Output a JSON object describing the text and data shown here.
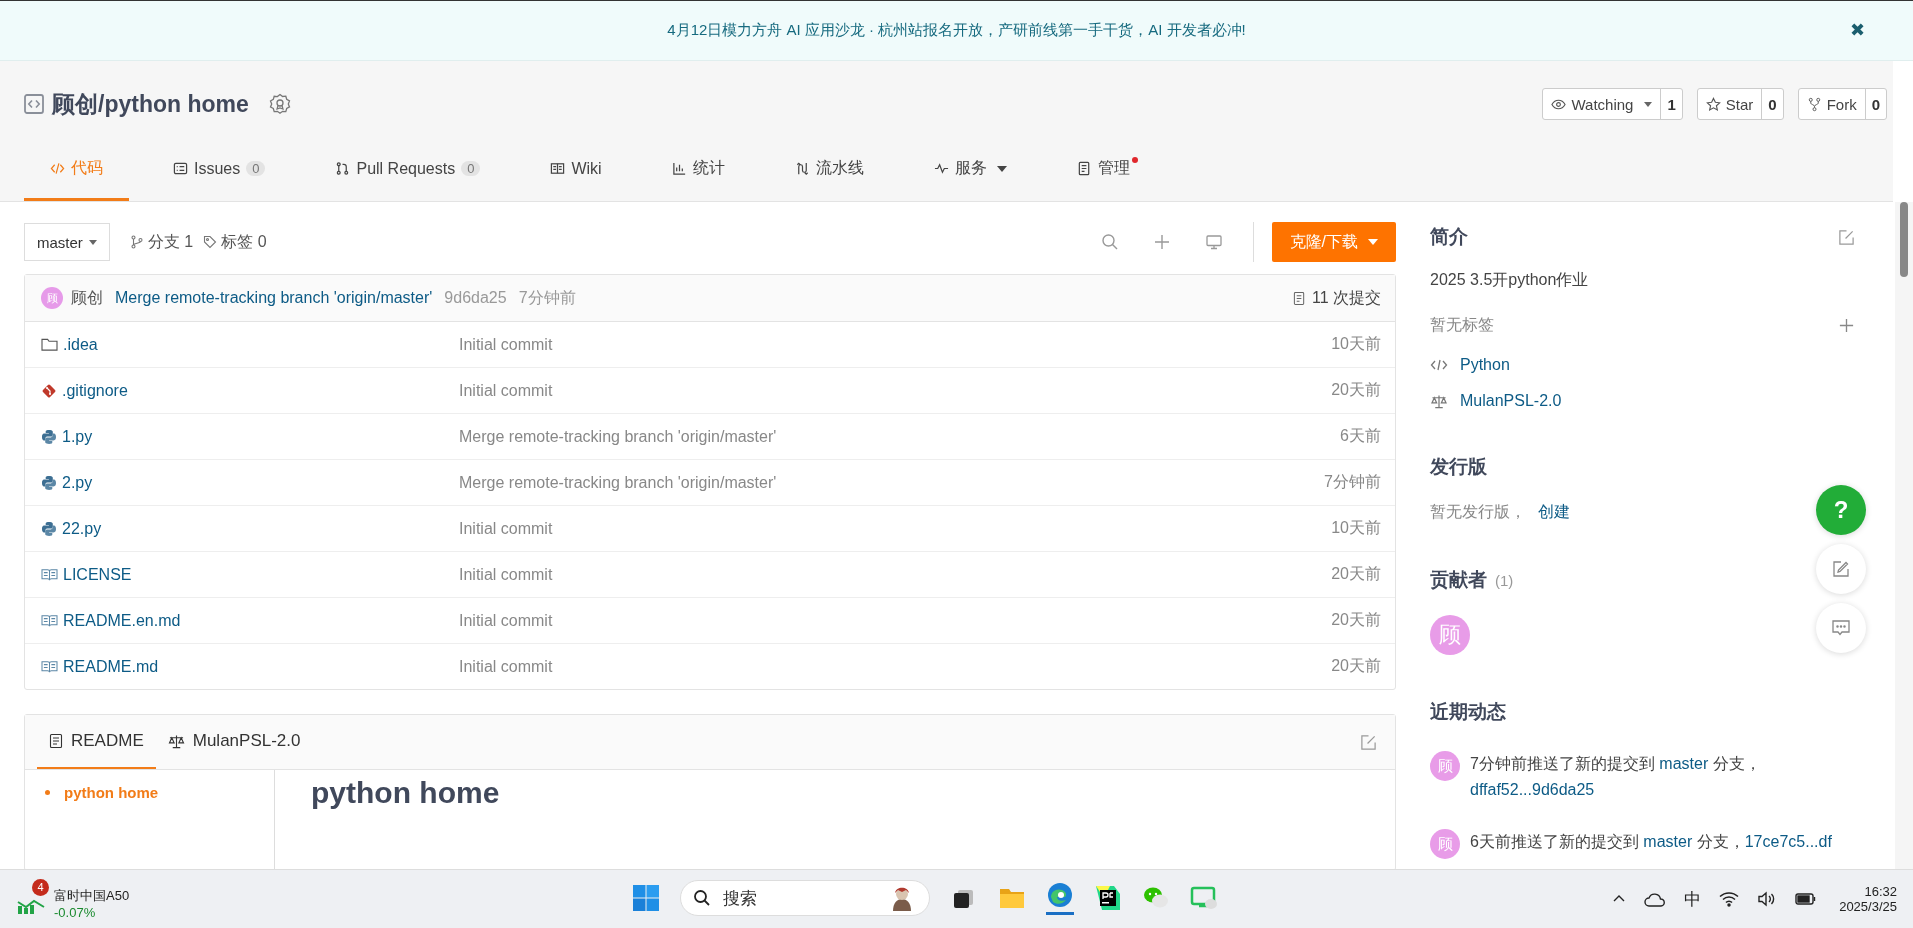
{
  "banner": {
    "text": "4月12日模力方舟 AI 应用沙龙 · 杭州站报名开放，产研前线第一手干货，AI 开发者必冲!",
    "close": "✖"
  },
  "repo": {
    "title": "顾创/python home",
    "actions": [
      {
        "label": "Watching",
        "count": "1",
        "caret": true
      },
      {
        "label": "Star",
        "count": "0",
        "caret": false
      },
      {
        "label": "Fork",
        "count": "0",
        "caret": false
      }
    ]
  },
  "tabs": [
    {
      "label": "代码",
      "selected": true
    },
    {
      "label": "Issues",
      "count": "0",
      "selected": false
    },
    {
      "label": "Pull Requests",
      "count": "0",
      "selected": false
    },
    {
      "label": "Wiki",
      "selected": false
    },
    {
      "label": "统计",
      "selected": false
    },
    {
      "label": "流水线",
      "selected": false
    },
    {
      "label": "服务",
      "caret": true,
      "selected": false
    },
    {
      "label": "管理",
      "dot": true,
      "selected": false
    }
  ],
  "toolbar": {
    "branch": "master",
    "branches": "分支 1",
    "tags": "标签 0",
    "clone": "克隆/下载"
  },
  "commit": {
    "avatar": "顾",
    "author": "顾创",
    "message": "Merge remote-tracking branch 'origin/master'",
    "hash": "9d6da25",
    "time": "7分钟前",
    "count": "11 次提交"
  },
  "files": [
    {
      "kind": "folder",
      "name": ".idea",
      "message": "Initial commit",
      "time": "10天前"
    },
    {
      "kind": "git",
      "name": ".gitignore",
      "message": "Initial commit",
      "time": "20天前"
    },
    {
      "kind": "python",
      "name": "1.py",
      "message": "Merge remote-tracking branch 'origin/master'",
      "time": "6天前"
    },
    {
      "kind": "python",
      "name": "2.py",
      "message": "Merge remote-tracking branch 'origin/master'",
      "time": "7分钟前"
    },
    {
      "kind": "python",
      "name": "22.py",
      "message": "Initial commit",
      "time": "10天前"
    },
    {
      "kind": "doc",
      "name": "LICENSE",
      "message": "Initial commit",
      "time": "20天前"
    },
    {
      "kind": "doc",
      "name": "README.en.md",
      "message": "Initial commit",
      "time": "20天前"
    },
    {
      "kind": "doc",
      "name": "README.md",
      "message": "Initial commit",
      "time": "20天前"
    }
  ],
  "readme": {
    "tabs": [
      {
        "label": "README",
        "selected": true
      },
      {
        "label": "MulanPSL-2.0",
        "selected": false
      }
    ],
    "toc": [
      {
        "label": "python home",
        "selected": true
      }
    ],
    "heading": "python home"
  },
  "sidebar": {
    "intro_title": "简介",
    "description": "2025 3.5开python作业",
    "no_tags": "暂无标签",
    "language": "Python",
    "license": "MulanPSL-2.0",
    "releases_title": "发行版",
    "no_releases": "暂无发行版，",
    "create": "创建",
    "contributors_title": "贡献者",
    "contributors_count": "(1)",
    "contributors": [
      "顾"
    ],
    "activity_title": "近期动态",
    "activity": [
      {
        "avatar": "顾",
        "text": "7分钟前推送了新的提交到",
        "branch": "master",
        "suffix": "分支，",
        "range": "dffaf52...9d6da25"
      },
      {
        "avatar": "顾",
        "text": "6天前推送了新的提交到",
        "branch": "master",
        "suffix": "分支，",
        "range": "17ce7c5...df"
      }
    ]
  },
  "float_buttons": {
    "help": "?"
  },
  "taskbar": {
    "widget": {
      "badge": "4",
      "name": "富时中国A50",
      "change": "-0.07%"
    },
    "search": "搜索",
    "ime": "中",
    "time": "16:32",
    "date": "2025/3/25"
  }
}
